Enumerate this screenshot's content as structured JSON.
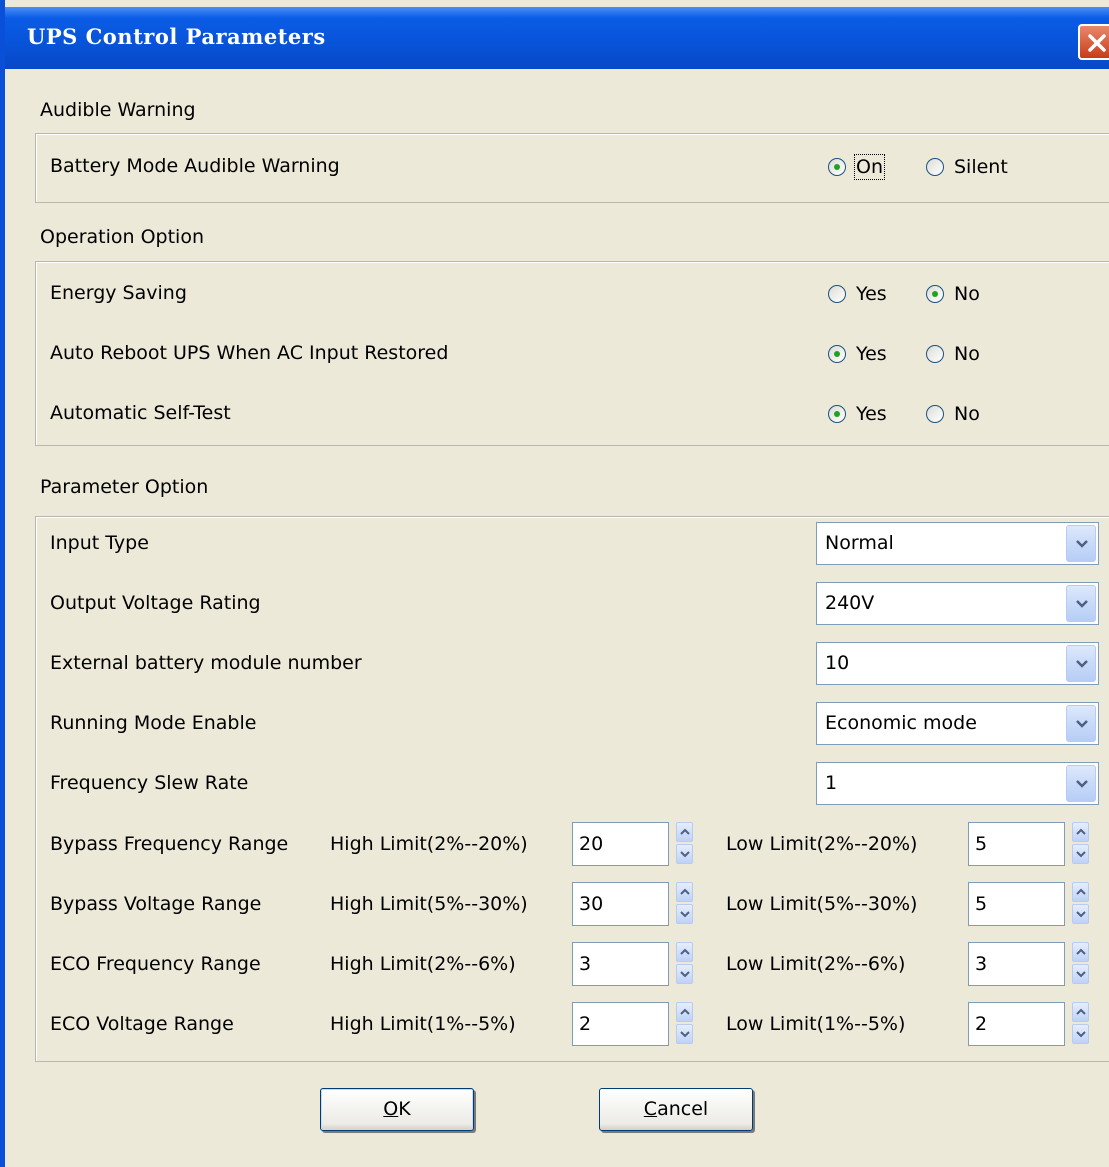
{
  "window": {
    "title": "UPS Control Parameters"
  },
  "audible": {
    "title": "Audible Warning",
    "battery_mode": {
      "label": "Battery Mode Audible Warning",
      "on_label": "On",
      "silent_label": "Silent",
      "selected": "On"
    }
  },
  "operation": {
    "title": "Operation Option",
    "rows": [
      {
        "label": "Energy Saving",
        "yes": "Yes",
        "no": "No",
        "selected": "No"
      },
      {
        "label": "Auto Reboot UPS When AC Input Restored",
        "yes": "Yes",
        "no": "No",
        "selected": "Yes"
      },
      {
        "label": "Automatic Self-Test",
        "yes": "Yes",
        "no": "No",
        "selected": "Yes"
      }
    ]
  },
  "parameter": {
    "title": "Parameter Option",
    "selects": [
      {
        "label": "Input Type",
        "value": "Normal"
      },
      {
        "label": "Output Voltage Rating",
        "value": "240V"
      },
      {
        "label": "External battery module number",
        "value": "10"
      },
      {
        "label": "Running Mode Enable",
        "value": "Economic mode"
      },
      {
        "label": "Frequency Slew Rate",
        "value": "1"
      }
    ],
    "ranges": [
      {
        "label": "Bypass Frequency Range",
        "high_label": "High Limit(2%--20%)",
        "high_value": "20",
        "low_label": "Low Limit(2%--20%)",
        "low_value": "5"
      },
      {
        "label": "Bypass Voltage Range",
        "high_label": "High Limit(5%--30%)",
        "high_value": "30",
        "low_label": "Low Limit(5%--30%)",
        "low_value": "5"
      },
      {
        "label": "ECO Frequency Range",
        "high_label": "High Limit(2%--6%)",
        "high_value": "3",
        "low_label": "Low Limit(2%--6%)",
        "low_value": "3"
      },
      {
        "label": "ECO Voltage Range",
        "high_label": "High Limit(1%--5%)",
        "high_value": "2",
        "low_label": "Low Limit(1%--5%)",
        "low_value": "2"
      }
    ]
  },
  "buttons": {
    "ok_mnemonic": "O",
    "ok_rest": "K",
    "cancel_mnemonic": "C",
    "cancel_rest": "ancel"
  },
  "colors": {
    "title_bar": "#0853d8",
    "dialog_bg": "#ece9d8",
    "radio_dot": "#21a121",
    "field_border": "#7f9db9"
  },
  "icons": {
    "close": "close-icon",
    "dropdown": "chevron-down-icon",
    "spin_up": "spin-up-icon",
    "spin_down": "spin-down-icon"
  }
}
